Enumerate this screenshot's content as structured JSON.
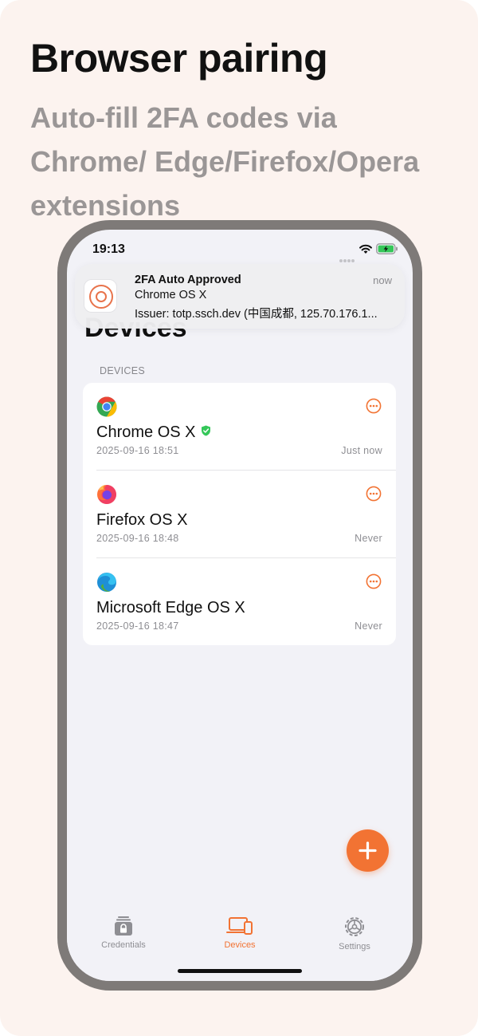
{
  "promo": {
    "title": "Browser pairing",
    "subtitle": "Auto-fill 2FA codes via Chrome/ Edge/Firefox/Opera extensions"
  },
  "status_bar": {
    "time": "19:13"
  },
  "notification": {
    "title": "2FA Auto Approved",
    "time": "now",
    "line1": "Chrome OS X",
    "line2": "Issuer: totp.ssch.dev (中国成都, 125.70.176.1..."
  },
  "page": {
    "title": "Devices",
    "section_header": "DEVICES"
  },
  "devices": [
    {
      "icon": "chrome-icon",
      "name": "Chrome OS X",
      "verified": true,
      "date": "2025-09-16 18:51",
      "last_used": "Just now"
    },
    {
      "icon": "firefox-icon",
      "name": "Firefox OS X",
      "verified": false,
      "date": "2025-09-16 18:48",
      "last_used": "Never"
    },
    {
      "icon": "edge-icon",
      "name": "Microsoft Edge OS X",
      "verified": false,
      "date": "2025-09-16 18:47",
      "last_used": "Never"
    }
  ],
  "tabs": [
    {
      "label": "Credentials",
      "icon": "lock-stack-icon",
      "active": false
    },
    {
      "label": "Devices",
      "icon": "devices-icon",
      "active": true
    },
    {
      "label": "Settings",
      "icon": "gear-icon",
      "active": false
    }
  ],
  "colors": {
    "accent": "#f27333",
    "verified": "#34c759",
    "background": "#fcf3ef"
  }
}
